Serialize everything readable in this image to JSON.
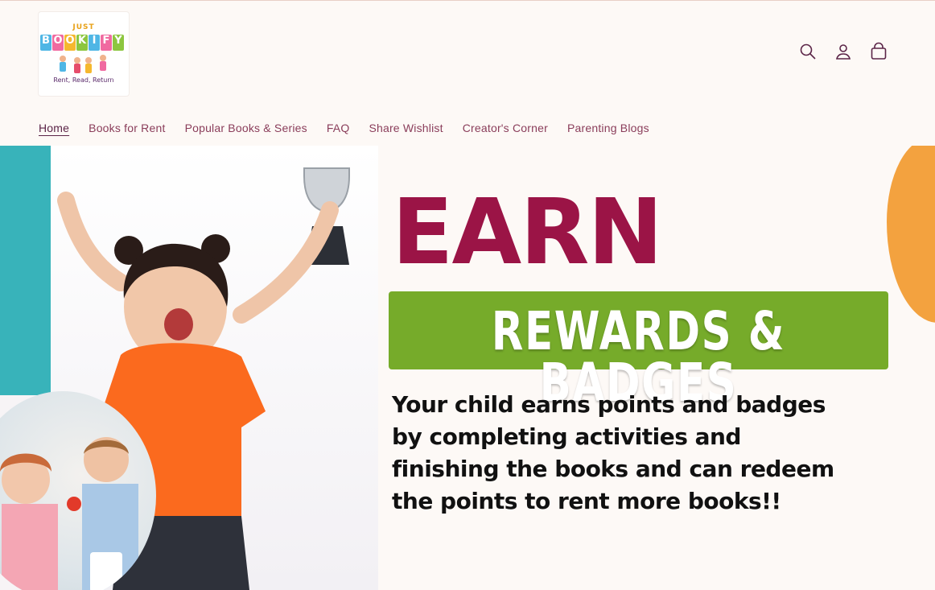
{
  "logo": {
    "top_text": "JUST",
    "tiles": [
      {
        "letter": "B",
        "color": "#4fb6e5"
      },
      {
        "letter": "O",
        "color": "#f06aa0"
      },
      {
        "letter": "O",
        "color": "#f5b82e"
      },
      {
        "letter": "K",
        "color": "#8cc63f"
      },
      {
        "letter": "I",
        "color": "#4fb6e5"
      },
      {
        "letter": "F",
        "color": "#f06aa0"
      },
      {
        "letter": "Y",
        "color": "#8cc63f"
      }
    ],
    "tagline": "Rent, Read, Return"
  },
  "header": {
    "icons": [
      "search-icon",
      "account-icon",
      "cart-icon"
    ]
  },
  "nav": {
    "items": [
      {
        "label": "Home",
        "active": true
      },
      {
        "label": "Books for Rent"
      },
      {
        "label": "Popular Books & Series"
      },
      {
        "label": "FAQ"
      },
      {
        "label": "Share Wishlist"
      },
      {
        "label": "Creator's Corner"
      },
      {
        "label": "Parenting Blogs"
      }
    ]
  },
  "hero": {
    "headline": "EARN",
    "banner": "REWARDS & BADGES",
    "description": "Your child earns points and badges by completing activities and finishing the books and can redeem the points to rent more books!!",
    "colors": {
      "headline": "#9b1446",
      "banner": "#76ab2a",
      "accent_teal": "#38b3ba",
      "accent_orange": "#f3a23f"
    }
  }
}
